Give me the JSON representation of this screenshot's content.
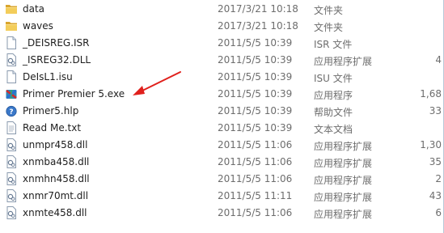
{
  "files": [
    {
      "name": "data",
      "date": "2017/3/21 10:18",
      "type": "文件夹",
      "size": "",
      "icon": "folder-icon"
    },
    {
      "name": "waves",
      "date": "2017/3/21 10:18",
      "type": "文件夹",
      "size": "",
      "icon": "folder-icon"
    },
    {
      "name": "_DEISREG.ISR",
      "date": "2011/5/5 10:39",
      "type": "ISR 文件",
      "size": "",
      "icon": "blank-file-icon"
    },
    {
      "name": "_ISREG32.DLL",
      "date": "2011/5/5 10:39",
      "type": "应用程序扩展",
      "size": "4",
      "icon": "dll-file-icon"
    },
    {
      "name": "DeIsL1.isu",
      "date": "2011/5/5 10:39",
      "type": "ISU 文件",
      "size": "",
      "icon": "blank-file-icon"
    },
    {
      "name": "Primer Premier 5.exe",
      "date": "2011/5/5 10:39",
      "type": "应用程序",
      "size": "1,68",
      "icon": "primer-app-icon"
    },
    {
      "name": "Primer5.hlp",
      "date": "2011/5/5 10:39",
      "type": "帮助文件",
      "size": "33",
      "icon": "help-file-icon"
    },
    {
      "name": "Read Me.txt",
      "date": "2011/5/5 10:39",
      "type": "文本文档",
      "size": "",
      "icon": "text-file-icon"
    },
    {
      "name": "unmpr458.dll",
      "date": "2011/5/5 11:06",
      "type": "应用程序扩展",
      "size": "1,30",
      "icon": "dll-file-icon"
    },
    {
      "name": "xnmba458.dll",
      "date": "2011/5/5 11:06",
      "type": "应用程序扩展",
      "size": "35",
      "icon": "dll-file-icon"
    },
    {
      "name": "xnmhn458.dll",
      "date": "2011/5/5 11:06",
      "type": "应用程序扩展",
      "size": "2",
      "icon": "dll-file-icon"
    },
    {
      "name": "xnmr70mt.dll",
      "date": "2011/5/5 11:11",
      "type": "应用程序扩展",
      "size": "43",
      "icon": "dll-file-icon"
    },
    {
      "name": "xnmte458.dll",
      "date": "2011/5/5 11:06",
      "type": "应用程序扩展",
      "size": "6",
      "icon": "dll-file-icon"
    }
  ],
  "colors": {
    "arrow": "#e0201c",
    "folder": "#e8b83c",
    "muted_text": "#6d6d6d"
  }
}
